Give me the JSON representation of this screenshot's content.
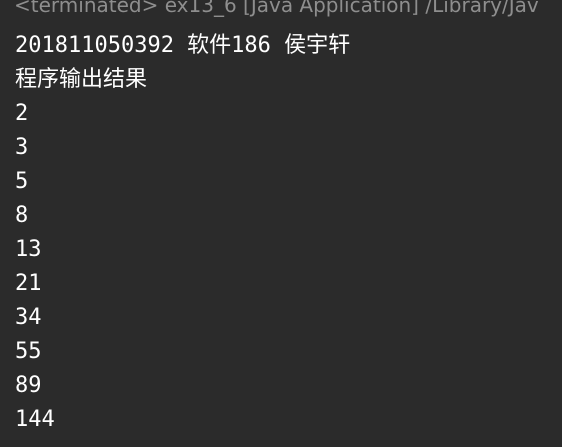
{
  "console": {
    "status": "<terminated> ex13_6 [Java Application] /Library/Jav",
    "lines": [
      "201811050392 软件186 侯宇轩",
      "程序输出结果",
      "2",
      "3",
      "5",
      "8",
      "13",
      "21",
      "34",
      "55",
      "89",
      "144"
    ]
  },
  "colors": {
    "background": "#2b2b2b",
    "text": "#ffffff",
    "status_text": "#8e8e8e"
  }
}
